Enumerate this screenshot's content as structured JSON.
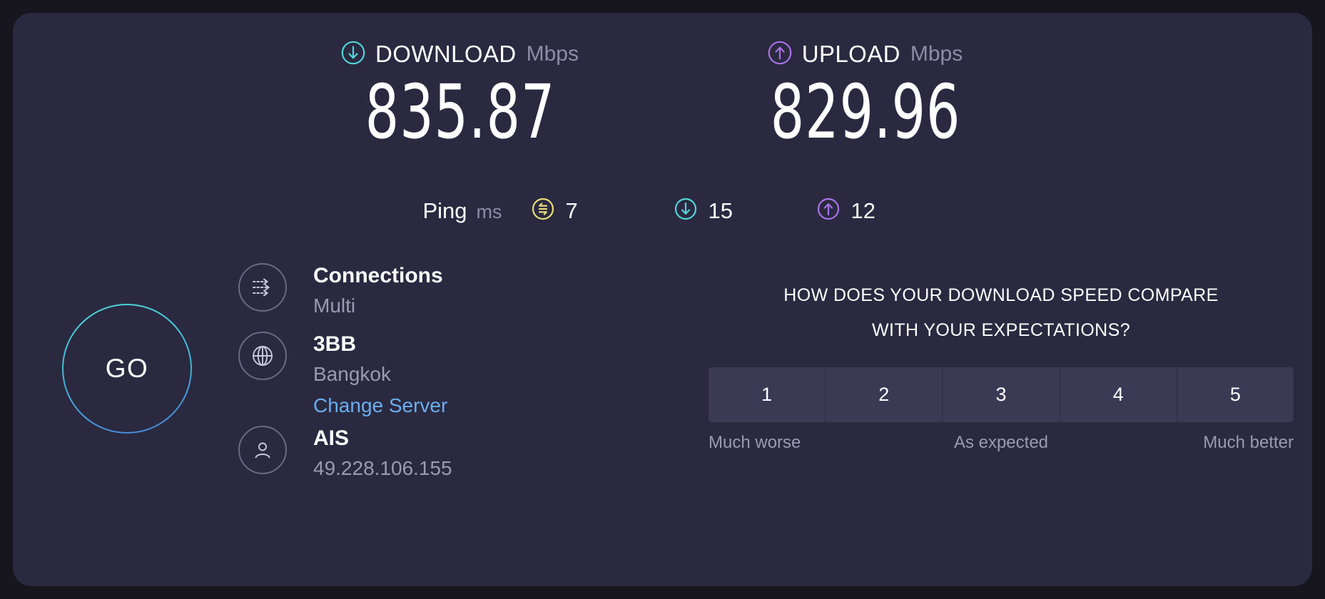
{
  "card": {
    "background": "#2a2940",
    "page_background": "#17161f"
  },
  "speeds": {
    "download": {
      "icon": "download-arrow-circle-icon",
      "label": "DOWNLOAD",
      "unit": "Mbps",
      "value": "835.87",
      "color": "#4fd6d6"
    },
    "upload": {
      "icon": "upload-arrow-circle-icon",
      "label": "UPLOAD",
      "unit": "Mbps",
      "value": "829.96",
      "color": "#a972e8"
    }
  },
  "ping": {
    "label": "Ping",
    "unit": "ms",
    "idle": {
      "icon": "exchange-latency-icon",
      "value": "7",
      "color": "#e8dd7a"
    },
    "download": {
      "icon": "download-latency-icon",
      "value": "15",
      "color": "#4fd6d6"
    },
    "upload": {
      "icon": "upload-latency-icon",
      "value": "12",
      "color": "#a972e8"
    }
  },
  "go_button": {
    "label": "GO",
    "gradient_start": "#4fd6d6",
    "gradient_end": "#4a82d8"
  },
  "connection": {
    "connections": {
      "icon": "multi-connection-arrows-icon",
      "title": "Connections",
      "value": "Multi"
    },
    "server": {
      "icon": "globe-icon",
      "title": "3BB",
      "value": "Bangkok",
      "change_link": "Change Server",
      "link_color": "#6aaef0"
    },
    "client": {
      "icon": "person-icon",
      "title": "AIS",
      "value": "49.228.106.155"
    }
  },
  "survey": {
    "question_line1": "HOW DOES YOUR DOWNLOAD SPEED COMPARE",
    "question_line2": "WITH YOUR EXPECTATIONS?",
    "ratings": [
      "1",
      "2",
      "3",
      "4",
      "5"
    ],
    "legend_low": "Much worse",
    "legend_mid": "As expected",
    "legend_high": "Much better"
  }
}
